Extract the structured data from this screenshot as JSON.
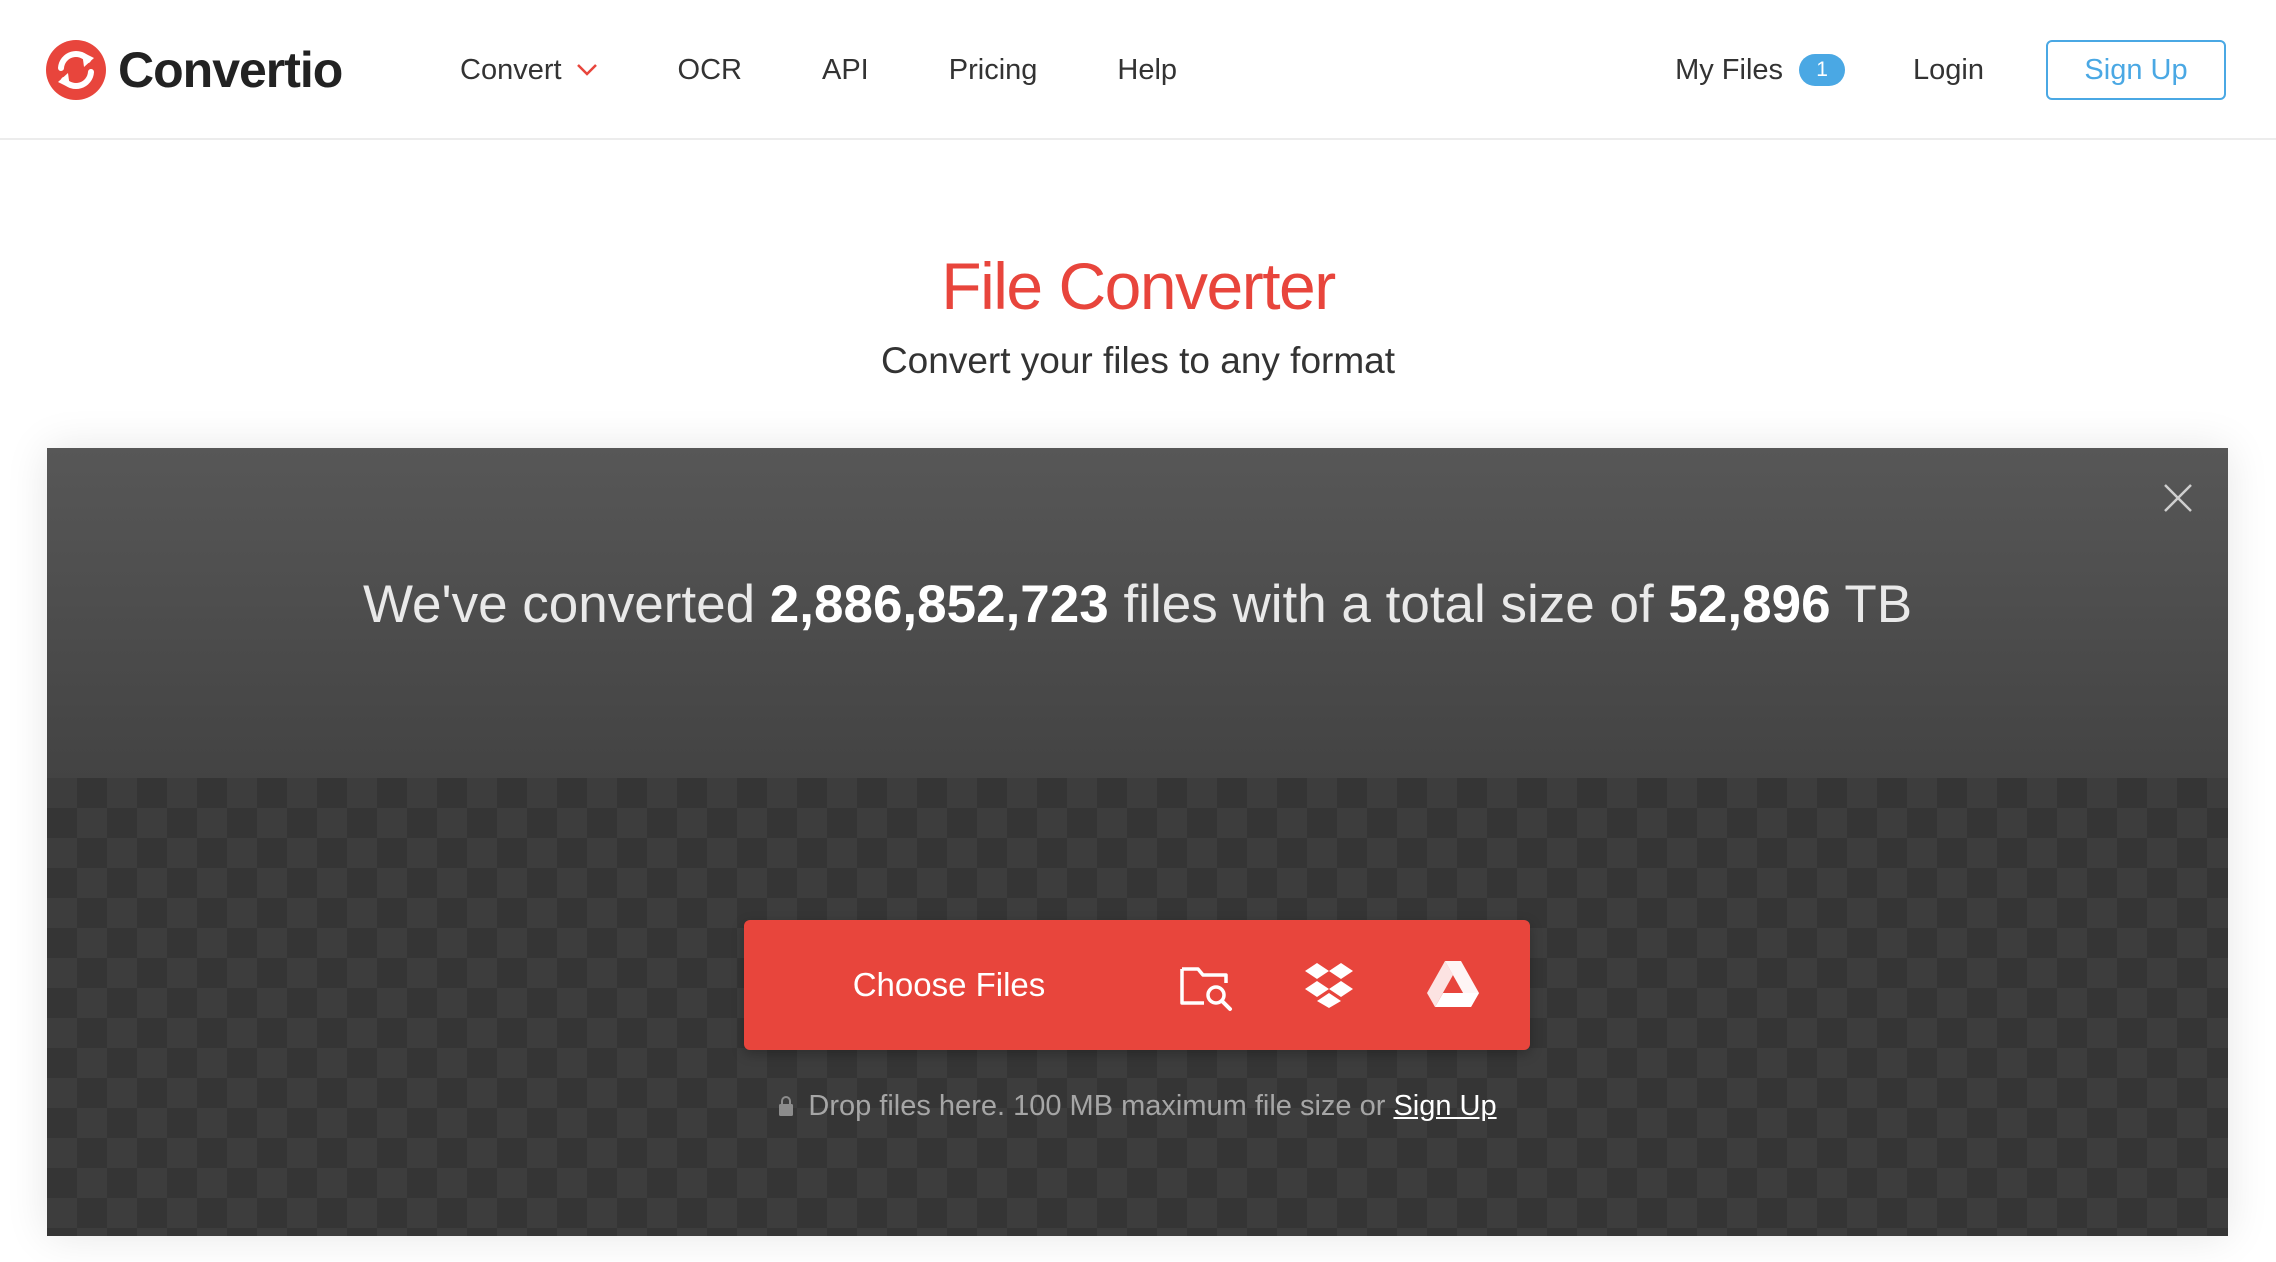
{
  "brand": {
    "name": "Convertio",
    "accent_color": "#e8453c",
    "link_color": "#4aa8e4"
  },
  "nav": {
    "items": [
      {
        "label": "Convert",
        "icon": "chevron-down-icon"
      },
      {
        "label": "OCR"
      },
      {
        "label": "API"
      },
      {
        "label": "Pricing"
      },
      {
        "label": "Help"
      }
    ]
  },
  "header_right": {
    "my_files_label": "My Files",
    "my_files_count": "1",
    "login_label": "Login",
    "signup_label": "Sign Up"
  },
  "hero": {
    "title": "File Converter",
    "subtitle": "Convert your files to any format"
  },
  "stats": {
    "prefix": "We've converted",
    "files_count": "2,886,852,723",
    "middle": "files with a total size of",
    "total_size": "52,896",
    "unit": "TB"
  },
  "upload": {
    "choose_label": "Choose Files",
    "sources": [
      "folder-search-icon",
      "dropbox-icon",
      "google-drive-icon"
    ],
    "note": "Drop files here. 100 MB maximum file size or",
    "signup_link": "Sign Up"
  }
}
